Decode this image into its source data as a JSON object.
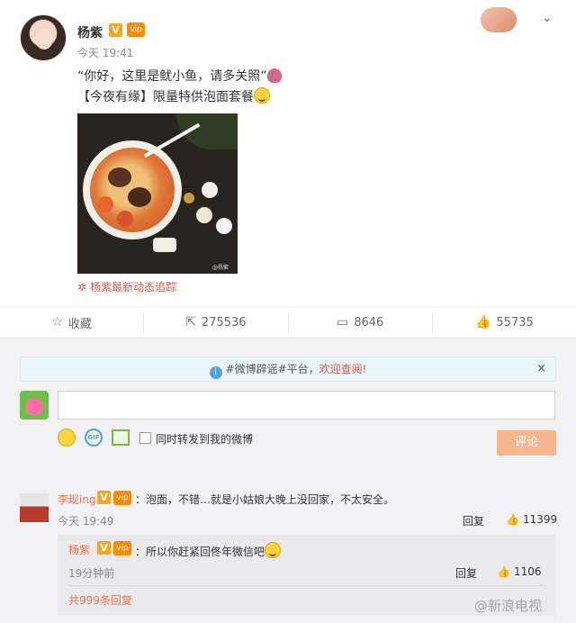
{
  "post": {
    "username": "杨紫",
    "v_badge": "V",
    "vip_badge": "vip",
    "time": "今天 19:41",
    "line1": "“你好，这里是鱿小鱼，请多关照”",
    "line2": "【今夜有缘】限量特供泡面套餐",
    "image_watermark": "@杨紫",
    "tracking_link": "杨紫最新动态追踪"
  },
  "actions": {
    "favorite": "收藏",
    "repost": "275536",
    "comment": "8646",
    "like": "55735"
  },
  "comments_panel": {
    "notice_prefix": "#微博辟谣#平台，",
    "notice_link": "欢迎查阅!",
    "notice_close": "×",
    "checkbox_label": "同时转发到我的微博",
    "submit_label": "评论"
  },
  "comment1": {
    "username": "李现ing",
    "v_badge": "V",
    "vip_badge": "vip",
    "text": "：泡面，不错…就是小姑娘大晚上没回家，不太安全。",
    "time": "今天 19:49",
    "reply_label": "回复",
    "likes": "11399"
  },
  "reply1": {
    "username": "杨紫",
    "v_badge": "V",
    "vip_badge": "vip",
    "text": "：所以你赶紧回佟年微信吧",
    "time": "19分钟前",
    "reply_label": "回复",
    "likes": "1106",
    "more_replies": "共999条回复"
  },
  "brand_watermark": "@新浪电视",
  "icons": {
    "favorite": "star-icon",
    "repost": "share-icon",
    "comment": "comment-icon",
    "like": "thumbs-up-icon"
  }
}
